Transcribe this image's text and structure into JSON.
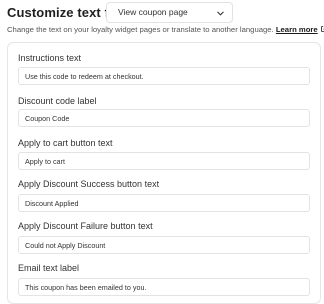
{
  "header": {
    "title": "Customize text for:",
    "selected_page": "View coupon page",
    "subtitle": "Change the text on your loyalty widget pages or translate to another language.",
    "learn_more": "Learn more"
  },
  "fields": [
    {
      "label": "Instructions text",
      "value": "Use this code to redeem at checkout."
    },
    {
      "label": "Discount code label",
      "value": "Coupon Code"
    },
    {
      "label": "Apply to cart button text",
      "value": "Apply to cart"
    },
    {
      "label": "Apply Discount Success button text",
      "value": "Discount Applied"
    },
    {
      "label": "Apply Discount Failure button text",
      "value": "Could not Apply Discount"
    },
    {
      "label": "Email text label",
      "value": "This coupon has been emailed to you."
    }
  ],
  "icons": {
    "dropdown": "chevron-down-icon",
    "external": "external-link-icon"
  }
}
